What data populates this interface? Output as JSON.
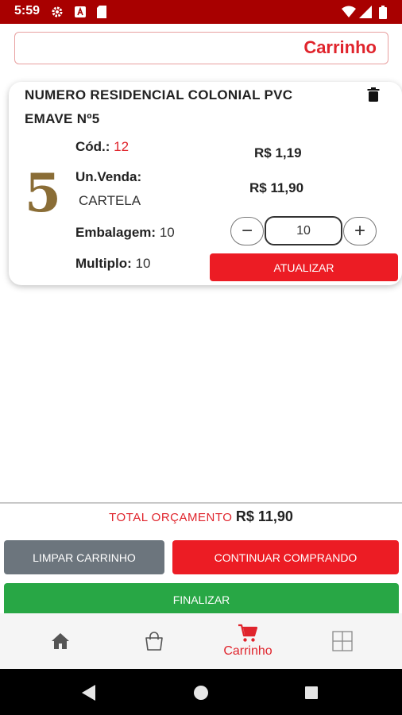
{
  "status_bar": {
    "time": "5:59"
  },
  "header": {
    "title": "Carrinho"
  },
  "product": {
    "name": "NUMERO RESIDENCIAL COLONIAL PVC EMAVE Nº5",
    "image_text": "5",
    "cod_label": "Cód.:",
    "cod_value": "12",
    "unit_label": "Un.Venda:",
    "unit_value": "CARTELA",
    "packaging_label": "Embalagem:",
    "packaging_value": "10",
    "multiple_label": "Multiplo:",
    "multiple_value": "10",
    "unit_price": "R$ 1,19",
    "total_price": "R$ 11,90",
    "quantity": "10",
    "update_label": "ATUALIZAR"
  },
  "summary": {
    "total_label": "TOTAL ORÇAMENTO",
    "total_value": "R$ 11,90"
  },
  "actions": {
    "clear_label": "LIMPAR CARRINHO",
    "continue_label": "CONTINUAR COMPRANDO",
    "finish_label": "FINALIZAR"
  },
  "bottom_nav": {
    "items": [
      {
        "icon": "home-icon",
        "label": ""
      },
      {
        "icon": "shopping-bag-icon",
        "label": ""
      },
      {
        "icon": "cart-icon",
        "label": "Carrinho",
        "active": true
      },
      {
        "icon": "grid-icon",
        "label": ""
      }
    ]
  },
  "colors": {
    "brand_red": "#ec1c24",
    "status_bar": "#a80000",
    "success_green": "#28a745",
    "secondary_gray": "#6c757d"
  }
}
